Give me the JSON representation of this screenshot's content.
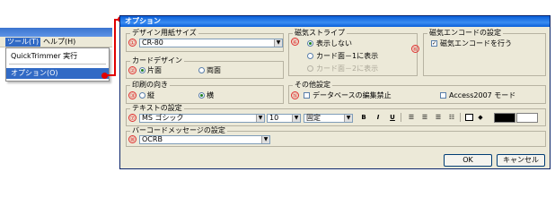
{
  "menubar": {
    "tools": "ツール(T)",
    "help": "ヘルプ(H)"
  },
  "menu": {
    "item1": "QuickTrimmer 実行",
    "item2": "オプション(O)"
  },
  "dialog": {
    "title": "オプション",
    "design_size": {
      "num": "①",
      "label": "デザイン用紙サイズ",
      "value": "CR-80"
    },
    "card_design": {
      "num": "②",
      "label": "カードデザイン",
      "opt1": "片面",
      "opt2": "両面"
    },
    "orientation": {
      "num": "③",
      "label": "印刷の向き",
      "opt1": "縦",
      "opt2": "横"
    },
    "mag_stripe": {
      "num": "④",
      "label": "磁気ストライプ",
      "opt1": "表示しない",
      "opt2": "カード面－1に表示",
      "opt3": "カード面－2に表示"
    },
    "other": {
      "num": "⑤",
      "label": "その他設定",
      "db_edit": "データベースの編集禁止",
      "access": "Access2007 モード"
    },
    "mag_encode": {
      "num": "⑥",
      "label": "磁気エンコードの設定",
      "check": "磁気エンコードを行う"
    },
    "text": {
      "num": "⑦",
      "label": "テキストの設定",
      "font": "MS ゴシック",
      "size": "10",
      "pitch": "固定",
      "bold": "B",
      "italic": "I",
      "underline": "U"
    },
    "barcode": {
      "num": "⑧",
      "label": "バーコードメッセージの設定",
      "value": "OCRB"
    },
    "ok": "OK",
    "cancel": "キャンセル"
  }
}
